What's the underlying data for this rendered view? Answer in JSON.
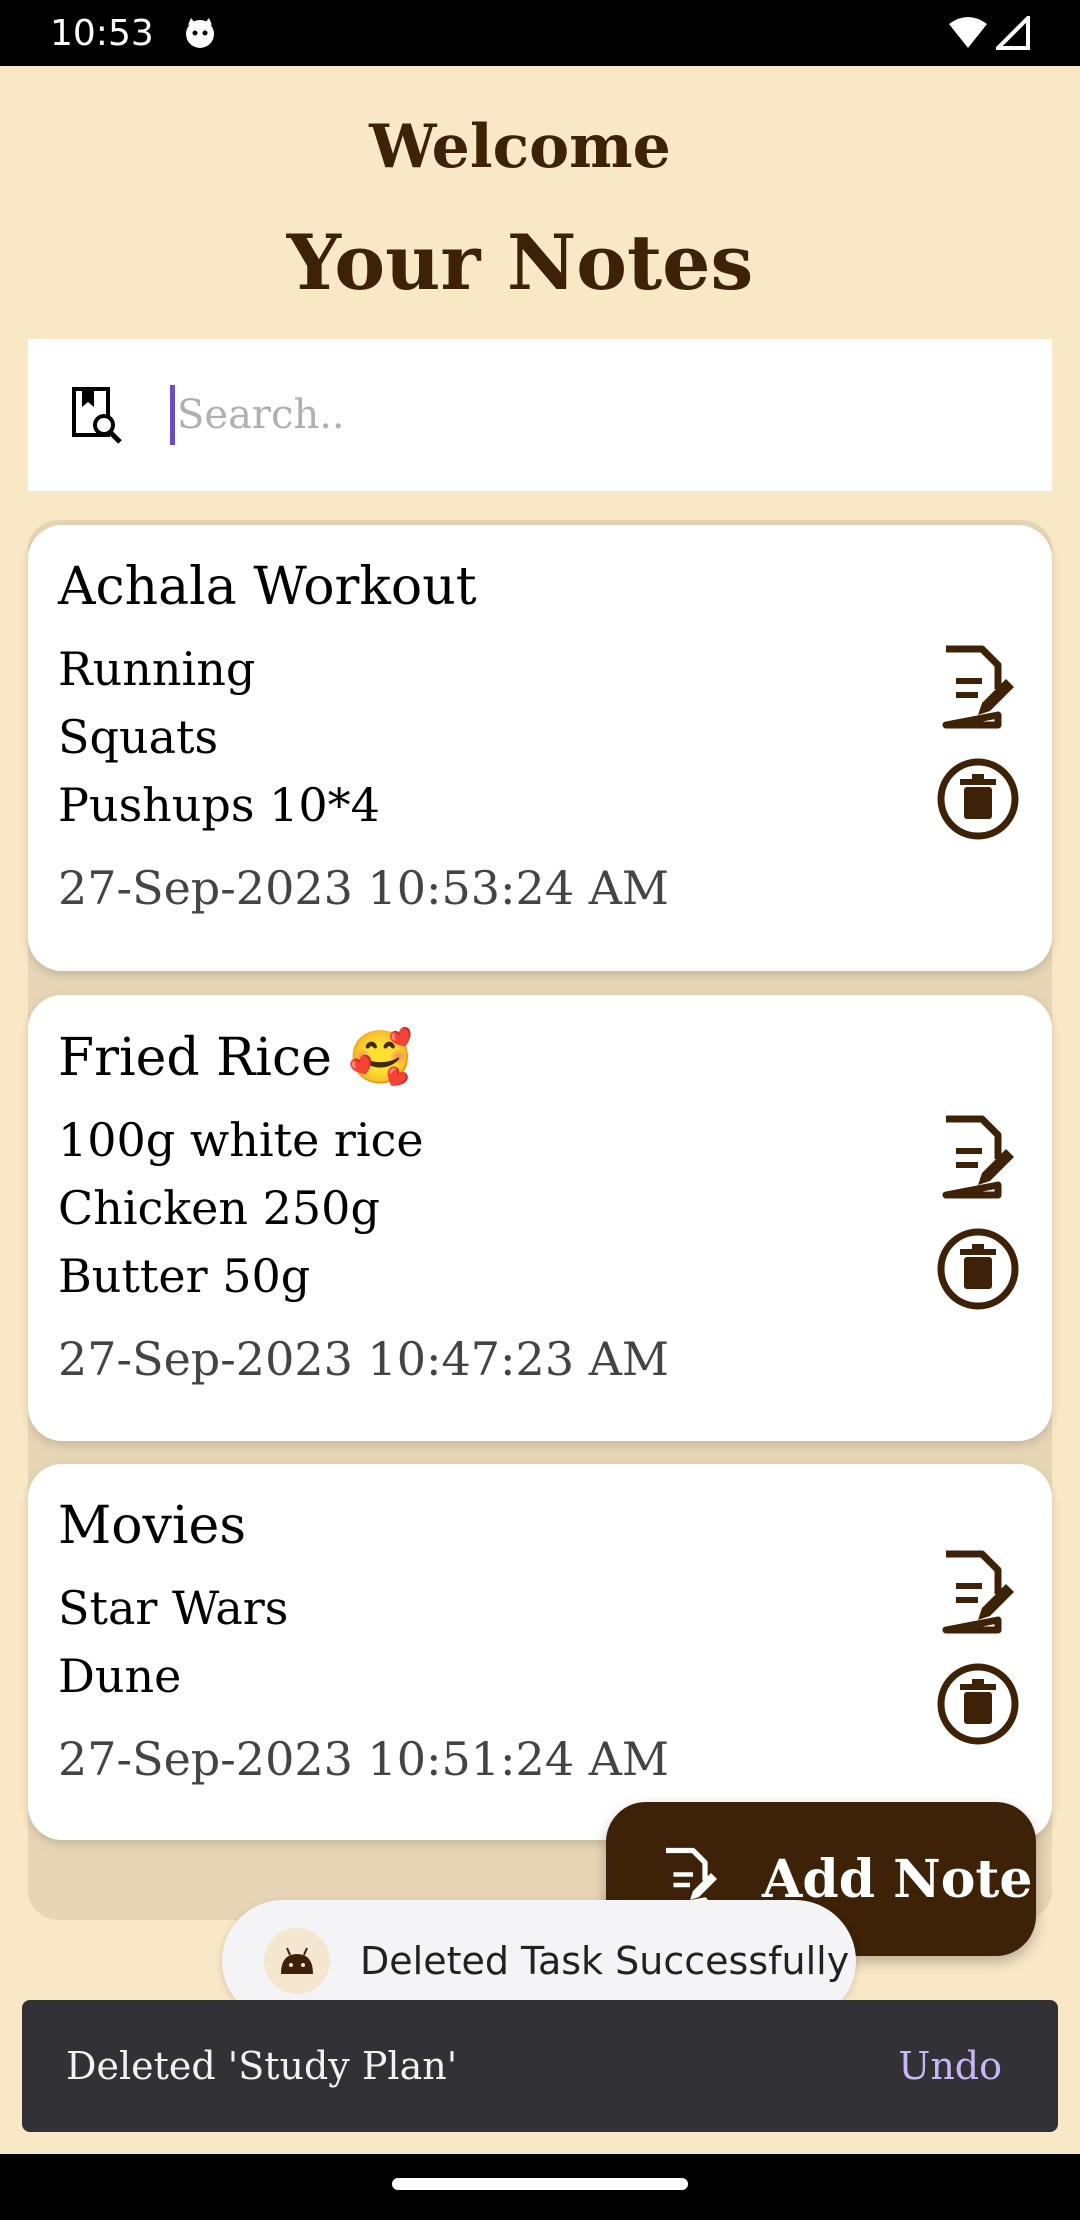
{
  "status": {
    "time": "10:53"
  },
  "header": {
    "welcome": "Welcome",
    "title": "Your Notes"
  },
  "search": {
    "placeholder": "Search.."
  },
  "notes": [
    {
      "title": "Achala Workout",
      "body": "Running\nSquats\nPushups 10*4",
      "date": "27-Sep-2023 10:53:24 AM"
    },
    {
      "title": "Fried Rice 🥰",
      "body": "100g white rice\nChicken 250g\nButter 50g",
      "date": "27-Sep-2023 10:47:23 AM"
    },
    {
      "title": "Movies",
      "body": "Star Wars\nDune",
      "date": "27-Sep-2023 10:51:24 AM"
    }
  ],
  "fab": {
    "label": "Add Note"
  },
  "toast": {
    "text": "Deleted Task Successfully"
  },
  "snackbar": {
    "text": "Deleted 'Study Plan'",
    "action": "Undo"
  },
  "colors": {
    "background": "#F9E8C6",
    "primary": "#3D2208",
    "undo": "#C7B8F5"
  },
  "icons": [
    "search-note-icon",
    "edit-note-icon",
    "delete-icon",
    "add-note-icon",
    "android-icon"
  ]
}
